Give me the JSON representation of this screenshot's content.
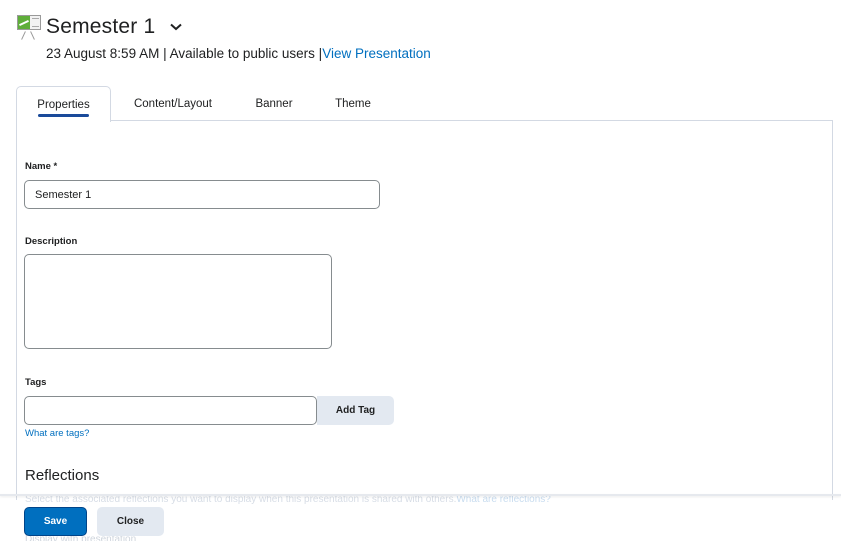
{
  "header": {
    "icon": "presentation-board-icon",
    "title": "Semester 1",
    "title_menu_icon": "chevron-down-icon",
    "meta_text": "23 August 8:59 AM | Available to public users |",
    "view_link": "View Presentation"
  },
  "tabs": [
    {
      "label": "Properties",
      "active": true
    },
    {
      "label": "Content/Layout",
      "active": false
    },
    {
      "label": "Banner",
      "active": false
    },
    {
      "label": "Theme",
      "active": false
    }
  ],
  "form": {
    "name": {
      "label": "Name *",
      "value": "Semester 1"
    },
    "description": {
      "label": "Description",
      "value": ""
    },
    "tags": {
      "label": "Tags",
      "value": "",
      "add_button": "Add Tag",
      "help_link": "What are tags?"
    }
  },
  "reflections": {
    "title": "Reflections",
    "description": "Select the associated reflections you want to display when this presentation is shared with others.",
    "help_link": "What are reflections?",
    "option_label": "Display with presentation"
  },
  "footer": {
    "save_label": "Save",
    "close_label": "Close"
  },
  "colors": {
    "accent": "#006fbf",
    "tab_indicator": "#1a4a9a",
    "secondary_button": "#e3e9f1"
  }
}
